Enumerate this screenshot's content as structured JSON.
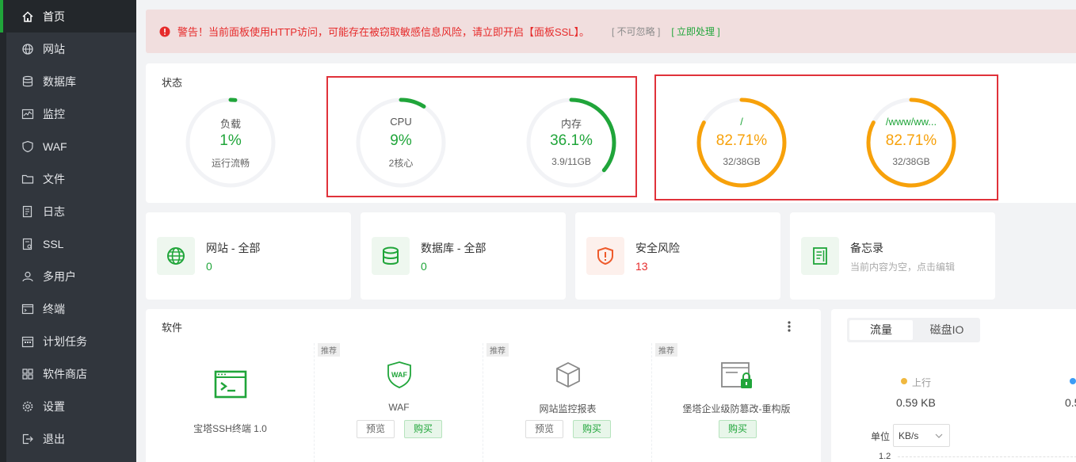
{
  "sidebar": {
    "items": [
      {
        "label": "首页",
        "icon": "home-icon"
      },
      {
        "label": "网站",
        "icon": "globe-icon"
      },
      {
        "label": "数据库",
        "icon": "database-icon"
      },
      {
        "label": "监控",
        "icon": "monitor-icon"
      },
      {
        "label": "WAF",
        "icon": "shield-icon"
      },
      {
        "label": "文件",
        "icon": "folder-icon"
      },
      {
        "label": "日志",
        "icon": "log-icon"
      },
      {
        "label": "SSL",
        "icon": "ssl-icon"
      },
      {
        "label": "多用户",
        "icon": "users-icon"
      },
      {
        "label": "终端",
        "icon": "terminal-icon"
      },
      {
        "label": "计划任务",
        "icon": "calendar-icon"
      },
      {
        "label": "软件商店",
        "icon": "grid-icon"
      },
      {
        "label": "设置",
        "icon": "gear-icon"
      },
      {
        "label": "退出",
        "icon": "logout-icon"
      }
    ]
  },
  "alert": {
    "message": "警告！当前面板使用HTTP访问，可能存在被窃取敏感信息风险，请立即开启【面板SSL】。",
    "ignore": "[ 不可忽略 ]",
    "handle": "[ 立即处理 ]"
  },
  "status": {
    "title": "状态",
    "gauges": [
      {
        "label": "负载",
        "value": "1%",
        "sub": "运行流畅",
        "fraction": 0.01,
        "color": "#20a53a"
      },
      {
        "label": "CPU",
        "value": "9%",
        "sub": "2核心",
        "fraction": 0.09,
        "color": "#20a53a"
      },
      {
        "label": "内存",
        "value": "36.1%",
        "sub": "3.9/11GB",
        "fraction": 0.361,
        "color": "#20a53a"
      },
      {
        "label": "/",
        "value": "82.71%",
        "sub": "32/38GB",
        "fraction": 0.8271,
        "color": "#f7a10a"
      },
      {
        "label": "/www/ww...",
        "value": "82.71%",
        "sub": "32/38GB",
        "fraction": 0.8271,
        "color": "#f7a10a"
      }
    ]
  },
  "overview": [
    {
      "name": "网站 - 全部",
      "value": "0",
      "icon": "globe-icon"
    },
    {
      "name": "数据库 - 全部",
      "value": "0",
      "icon": "database-icon"
    },
    {
      "name": "安全风险",
      "value": "13",
      "icon": "shield-alert-icon",
      "color": "#e62b2b"
    },
    {
      "name": "备忘录",
      "value": "当前内容为空，点击编辑",
      "icon": "memo-icon",
      "color": "#aaaaaa"
    }
  ],
  "software": {
    "title": "软件",
    "items": [
      {
        "name": "宝塔SSH终端 1.0",
        "tag": "",
        "buttons": []
      },
      {
        "name": "WAF",
        "tag": "推荐",
        "buttons": [
          "预览",
          "购买"
        ]
      },
      {
        "name": "网站监控报表",
        "tag": "推荐",
        "buttons": [
          "预览",
          "购买"
        ]
      },
      {
        "name": "堡塔企业级防篡改-重构版",
        "tag": "推荐",
        "buttons": [
          "购买"
        ]
      }
    ]
  },
  "traffic": {
    "tabs": [
      "流量",
      "磁盘IO"
    ],
    "upload_label": "上行",
    "upload_value": "0.59 KB",
    "upload_color": "#f0b83f",
    "download_value": "0.5",
    "download_color": "#3c9cf5",
    "unit_label": "单位",
    "unit_value": "KB/s",
    "axis_tick": "1.2"
  },
  "colors": {
    "accent": "#20a53a",
    "warning": "#f7a10a",
    "danger": "#e62b2b"
  }
}
